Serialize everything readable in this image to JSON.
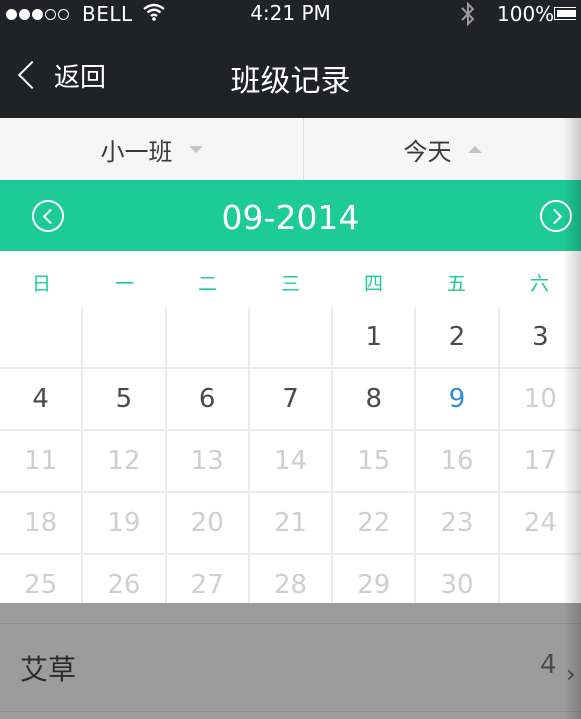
{
  "status_bar": {
    "carrier": "BELL",
    "time": "4:21 PM",
    "battery": "100%",
    "signal_bars_filled": 3,
    "signal_bars_total": 5
  },
  "nav": {
    "back_label": "返回",
    "title": "班级记录"
  },
  "filters": {
    "class_label": "小一班",
    "range_label": "今天"
  },
  "calendar": {
    "month_label": "09-2014",
    "weekdays": [
      "日",
      "一",
      "二",
      "三",
      "四",
      "五",
      "六"
    ],
    "days": [
      {
        "label": "",
        "state": "empty"
      },
      {
        "label": "",
        "state": "empty"
      },
      {
        "label": "",
        "state": "empty"
      },
      {
        "label": "",
        "state": "empty"
      },
      {
        "label": "1",
        "state": "normal"
      },
      {
        "label": "2",
        "state": "normal"
      },
      {
        "label": "3",
        "state": "normal"
      },
      {
        "label": "4",
        "state": "normal"
      },
      {
        "label": "5",
        "state": "normal"
      },
      {
        "label": "6",
        "state": "normal"
      },
      {
        "label": "7",
        "state": "normal"
      },
      {
        "label": "8",
        "state": "normal"
      },
      {
        "label": "9",
        "state": "today"
      },
      {
        "label": "10",
        "state": "faded"
      },
      {
        "label": "11",
        "state": "faded"
      },
      {
        "label": "12",
        "state": "faded"
      },
      {
        "label": "13",
        "state": "faded"
      },
      {
        "label": "14",
        "state": "faded"
      },
      {
        "label": "15",
        "state": "faded"
      },
      {
        "label": "16",
        "state": "faded"
      },
      {
        "label": "17",
        "state": "faded"
      },
      {
        "label": "18",
        "state": "faded"
      },
      {
        "label": "19",
        "state": "faded"
      },
      {
        "label": "20",
        "state": "faded"
      },
      {
        "label": "21",
        "state": "faded"
      },
      {
        "label": "22",
        "state": "faded"
      },
      {
        "label": "23",
        "state": "faded"
      },
      {
        "label": "24",
        "state": "faded"
      },
      {
        "label": "25",
        "state": "faded"
      },
      {
        "label": "26",
        "state": "faded"
      },
      {
        "label": "27",
        "state": "faded"
      },
      {
        "label": "28",
        "state": "faded"
      },
      {
        "label": "29",
        "state": "faded"
      },
      {
        "label": "30",
        "state": "faded"
      },
      {
        "label": "",
        "state": "empty"
      }
    ]
  },
  "list": {
    "items": [
      {
        "name": "艾草",
        "count": "4"
      }
    ]
  },
  "colors": {
    "header_bg": "#202226",
    "accent": "#1ccb97",
    "today": "#2b8ed8",
    "faded_day": "#cfcfcf"
  },
  "icons": {
    "back": "chevron-left-icon",
    "prev_month": "circle-chevron-left-icon",
    "next_month": "circle-chevron-right-icon",
    "wifi": "wifi-icon",
    "bluetooth": "bluetooth-icon",
    "battery": "battery-icon"
  }
}
